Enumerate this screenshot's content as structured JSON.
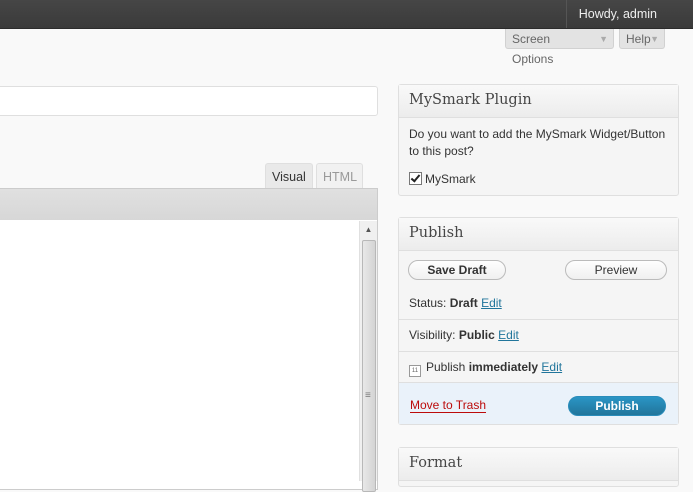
{
  "adminbar": {
    "greeting": "Howdy, admin"
  },
  "screen_meta": {
    "screen_options_label": "Screen Options",
    "help_label": "Help"
  },
  "editor": {
    "title_value": "",
    "tabs": [
      {
        "label": "Visual"
      },
      {
        "label": "HTML"
      }
    ],
    "active_tab": "Visual"
  },
  "mysmark": {
    "title": "MySmark Plugin",
    "question": "Do you want to add the MySmark Widget/Button to this post?",
    "checkbox_label": "MySmark",
    "checked": true
  },
  "publish": {
    "title": "Publish",
    "save_draft_label": "Save Draft",
    "preview_label": "Preview",
    "status_label": "Status:",
    "status_value": "Draft",
    "visibility_label": "Visibility:",
    "visibility_value": "Public",
    "schedule_label": "Publish",
    "schedule_value": "immediately",
    "edit_label": "Edit",
    "trash_label": "Move to Trash",
    "publish_label": "Publish",
    "colors": {
      "primary": "#21759b",
      "trash": "#bc0b0b"
    }
  },
  "format": {
    "title": "Format"
  }
}
